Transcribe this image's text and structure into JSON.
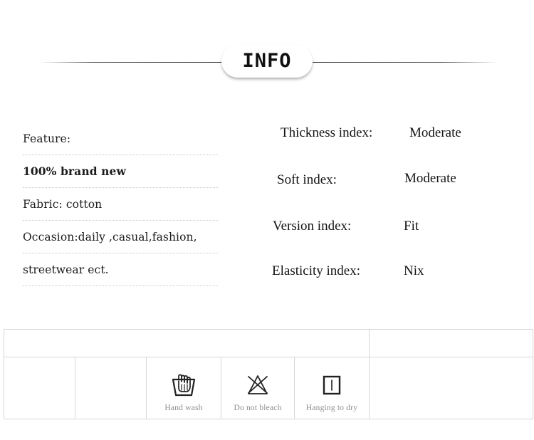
{
  "header": {
    "title": "INFO",
    "rule_icon": "horizontal-rule"
  },
  "features": {
    "rows": [
      {
        "text": "Feature:",
        "bold": false
      },
      {
        "text": "100% brand new",
        "bold": true
      },
      {
        "text": "Fabric: cotton",
        "bold": false
      },
      {
        "text": "Occasion:daily ,casual,fashion,",
        "bold": false
      },
      {
        "text": "streetwear ect.",
        "bold": false
      }
    ]
  },
  "indices": {
    "rows": [
      {
        "label": "Thickness index:",
        "value": "Moderate"
      },
      {
        "label": "Soft index:",
        "value": "Moderate"
      },
      {
        "label": "Version index:",
        "value": "Fit"
      },
      {
        "label": "Elasticity index:",
        "value": "Nix"
      }
    ]
  },
  "care_table": {
    "top_row": [
      "",
      ""
    ],
    "cells": [
      {
        "icon": "",
        "label": ""
      },
      {
        "icon": "",
        "label": ""
      },
      {
        "icon": "hand-wash-icon",
        "label": "Hand wash"
      },
      {
        "icon": "do-not-bleach-icon",
        "label": "Do not bleach"
      },
      {
        "icon": "hanging-to-dry-icon",
        "label": "Hanging to dry"
      },
      {
        "icon": "",
        "label": ""
      }
    ]
  },
  "colors": {
    "background": "#ffffff",
    "text": "#1a1a1a",
    "muted_text": "#8e8e8e",
    "table_border": "#d6d6d6",
    "dotted_divider": "#c9c9c9",
    "rule": "#2b2b2b"
  }
}
